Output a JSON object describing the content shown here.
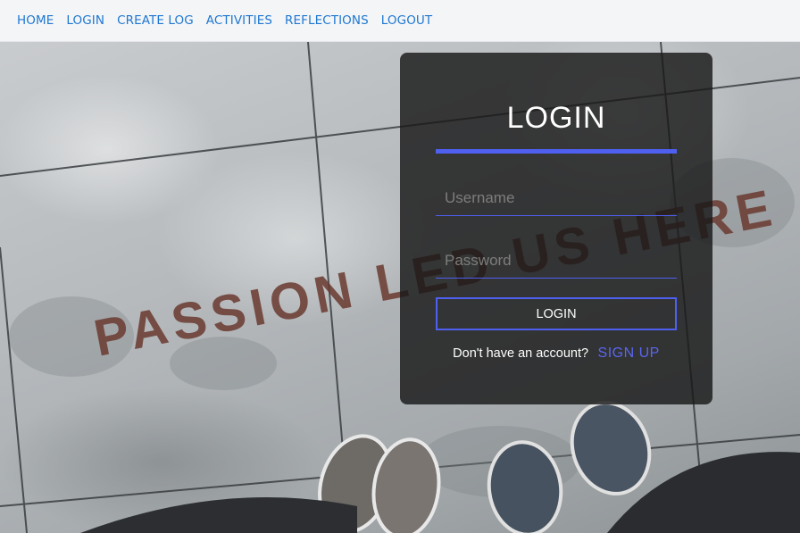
{
  "nav": {
    "items": [
      {
        "label": "HOME"
      },
      {
        "label": "LOGIN"
      },
      {
        "label": "CREATE LOG"
      },
      {
        "label": "ACTIVITIES"
      },
      {
        "label": "REFLECTIONS"
      },
      {
        "label": "LOGOUT"
      }
    ]
  },
  "background": {
    "sidewalk_text": "PASSION LED US HERE"
  },
  "login": {
    "title": "LOGIN",
    "username_placeholder": "Username",
    "password_placeholder": "Password",
    "button_label": "LOGIN",
    "signup_prompt": "Don't have an account?",
    "signup_link": "SIGN UP"
  },
  "colors": {
    "accent": "#4f5ff0",
    "nav_link": "#1f78d1",
    "card_bg": "#181818"
  }
}
